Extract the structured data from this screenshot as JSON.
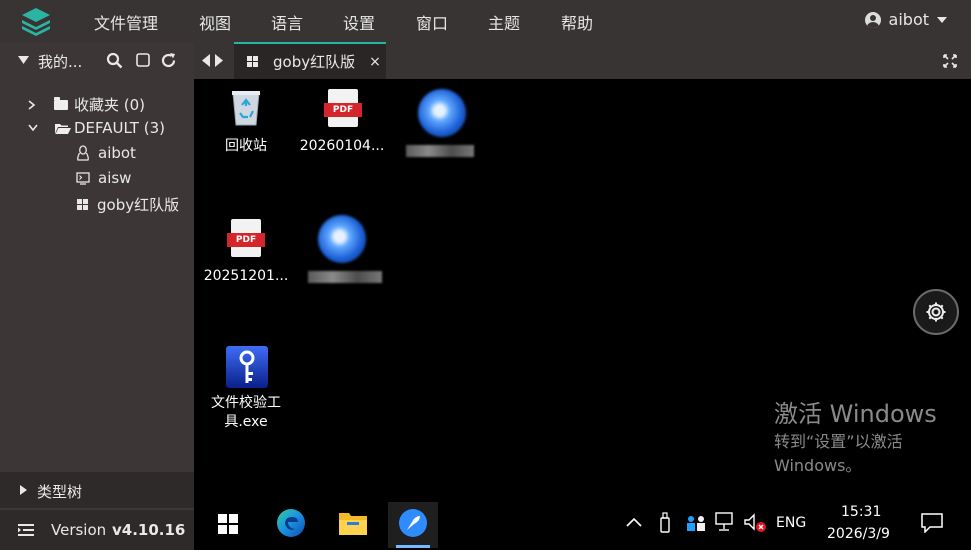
{
  "menubar": {
    "items": [
      "文件管理",
      "视图",
      "语言",
      "设置",
      "窗口",
      "主题",
      "帮助"
    ],
    "user_name": "aibot"
  },
  "sidebar": {
    "title": "我的...",
    "tree": [
      {
        "label": "收藏夹 (0)",
        "icon": "folder-icon",
        "expanded": false
      },
      {
        "label": "DEFAULT (3)",
        "icon": "folder-open-icon",
        "expanded": true
      },
      {
        "label": "aibot",
        "icon": "linux-icon"
      },
      {
        "label": "aisw",
        "icon": "terminal-icon"
      },
      {
        "label": "goby红队版",
        "icon": "windows-icon"
      }
    ],
    "footer_label": "类型树",
    "version_prefix": "Version",
    "version": "v4.10.16"
  },
  "tabs": [
    {
      "label": "goby红队版",
      "close": "×",
      "icon": "windows-icon"
    }
  ],
  "desktop": {
    "icons": [
      {
        "label": "回收站",
        "icon": "recycle-bin-icon"
      },
      {
        "label": "20260104...",
        "icon": "pdf-icon"
      },
      {
        "label": "20251201...",
        "icon": "pdf-icon"
      },
      {
        "label": "文件校验工具.exe",
        "label_line1": "文件校验工",
        "label_line2": "具.exe",
        "icon": "key-app-icon"
      }
    ],
    "pdf_badge": "PDF",
    "activate": {
      "title": "激活 Windows",
      "line1": "转到“设置”以激活",
      "line2": "Windows。"
    }
  },
  "taskbar": {
    "lang": "ENG",
    "time": "15:31",
    "date": "2026/3/9"
  },
  "colors": {
    "accent": "#2bb3a3",
    "menubar_bg": "#393434",
    "sidebar_bg": "#3c3636",
    "pdf_red": "#d3262c"
  }
}
